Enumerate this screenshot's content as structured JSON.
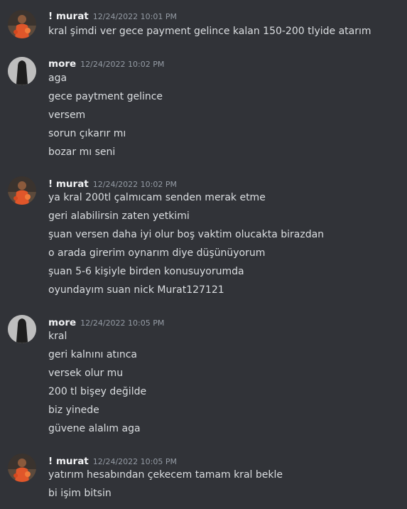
{
  "groups": [
    {
      "username": "! murat",
      "timestamp": "12/24/2022 10:01 PM",
      "avatar": "orange-figure-avatar",
      "lines": [
        "kral şimdi ver gece payment gelince kalan 150-200 tlyide atarım"
      ]
    },
    {
      "username": "more",
      "timestamp": "12/24/2022 10:02 PM",
      "avatar": "dark-cloaked-figure-avatar",
      "lines": [
        "aga",
        "gece paytment gelince",
        "versem",
        "sorun çıkarır mı",
        "bozar mı seni"
      ]
    },
    {
      "username": "! murat",
      "timestamp": "12/24/2022 10:02 PM",
      "avatar": "orange-figure-avatar",
      "lines": [
        "ya kral 200tl çalmıcam senden merak etme",
        "geri alabilirsin zaten yetkimi",
        "şuan versen daha iyi olur boş vaktim olucakta birazdan",
        "o arada girerim oynarım diye düşünüyorum",
        "şuan 5-6 kişiyle birden konusuyorumda",
        "oyundayım suan nick Murat127121"
      ]
    },
    {
      "username": "more",
      "timestamp": "12/24/2022 10:05 PM",
      "avatar": "dark-cloaked-figure-avatar",
      "lines": [
        "kral",
        "geri kalnını atınca",
        "versek olur mu",
        "200 tl bişey değilde",
        "biz yinede",
        "güvene alalım aga"
      ]
    },
    {
      "username": "! murat",
      "timestamp": "12/24/2022 10:05 PM",
      "avatar": "orange-figure-avatar",
      "lines": [
        "yatırım hesabından çekecem tamam kral bekle",
        "bi işim bitsin"
      ]
    }
  ]
}
